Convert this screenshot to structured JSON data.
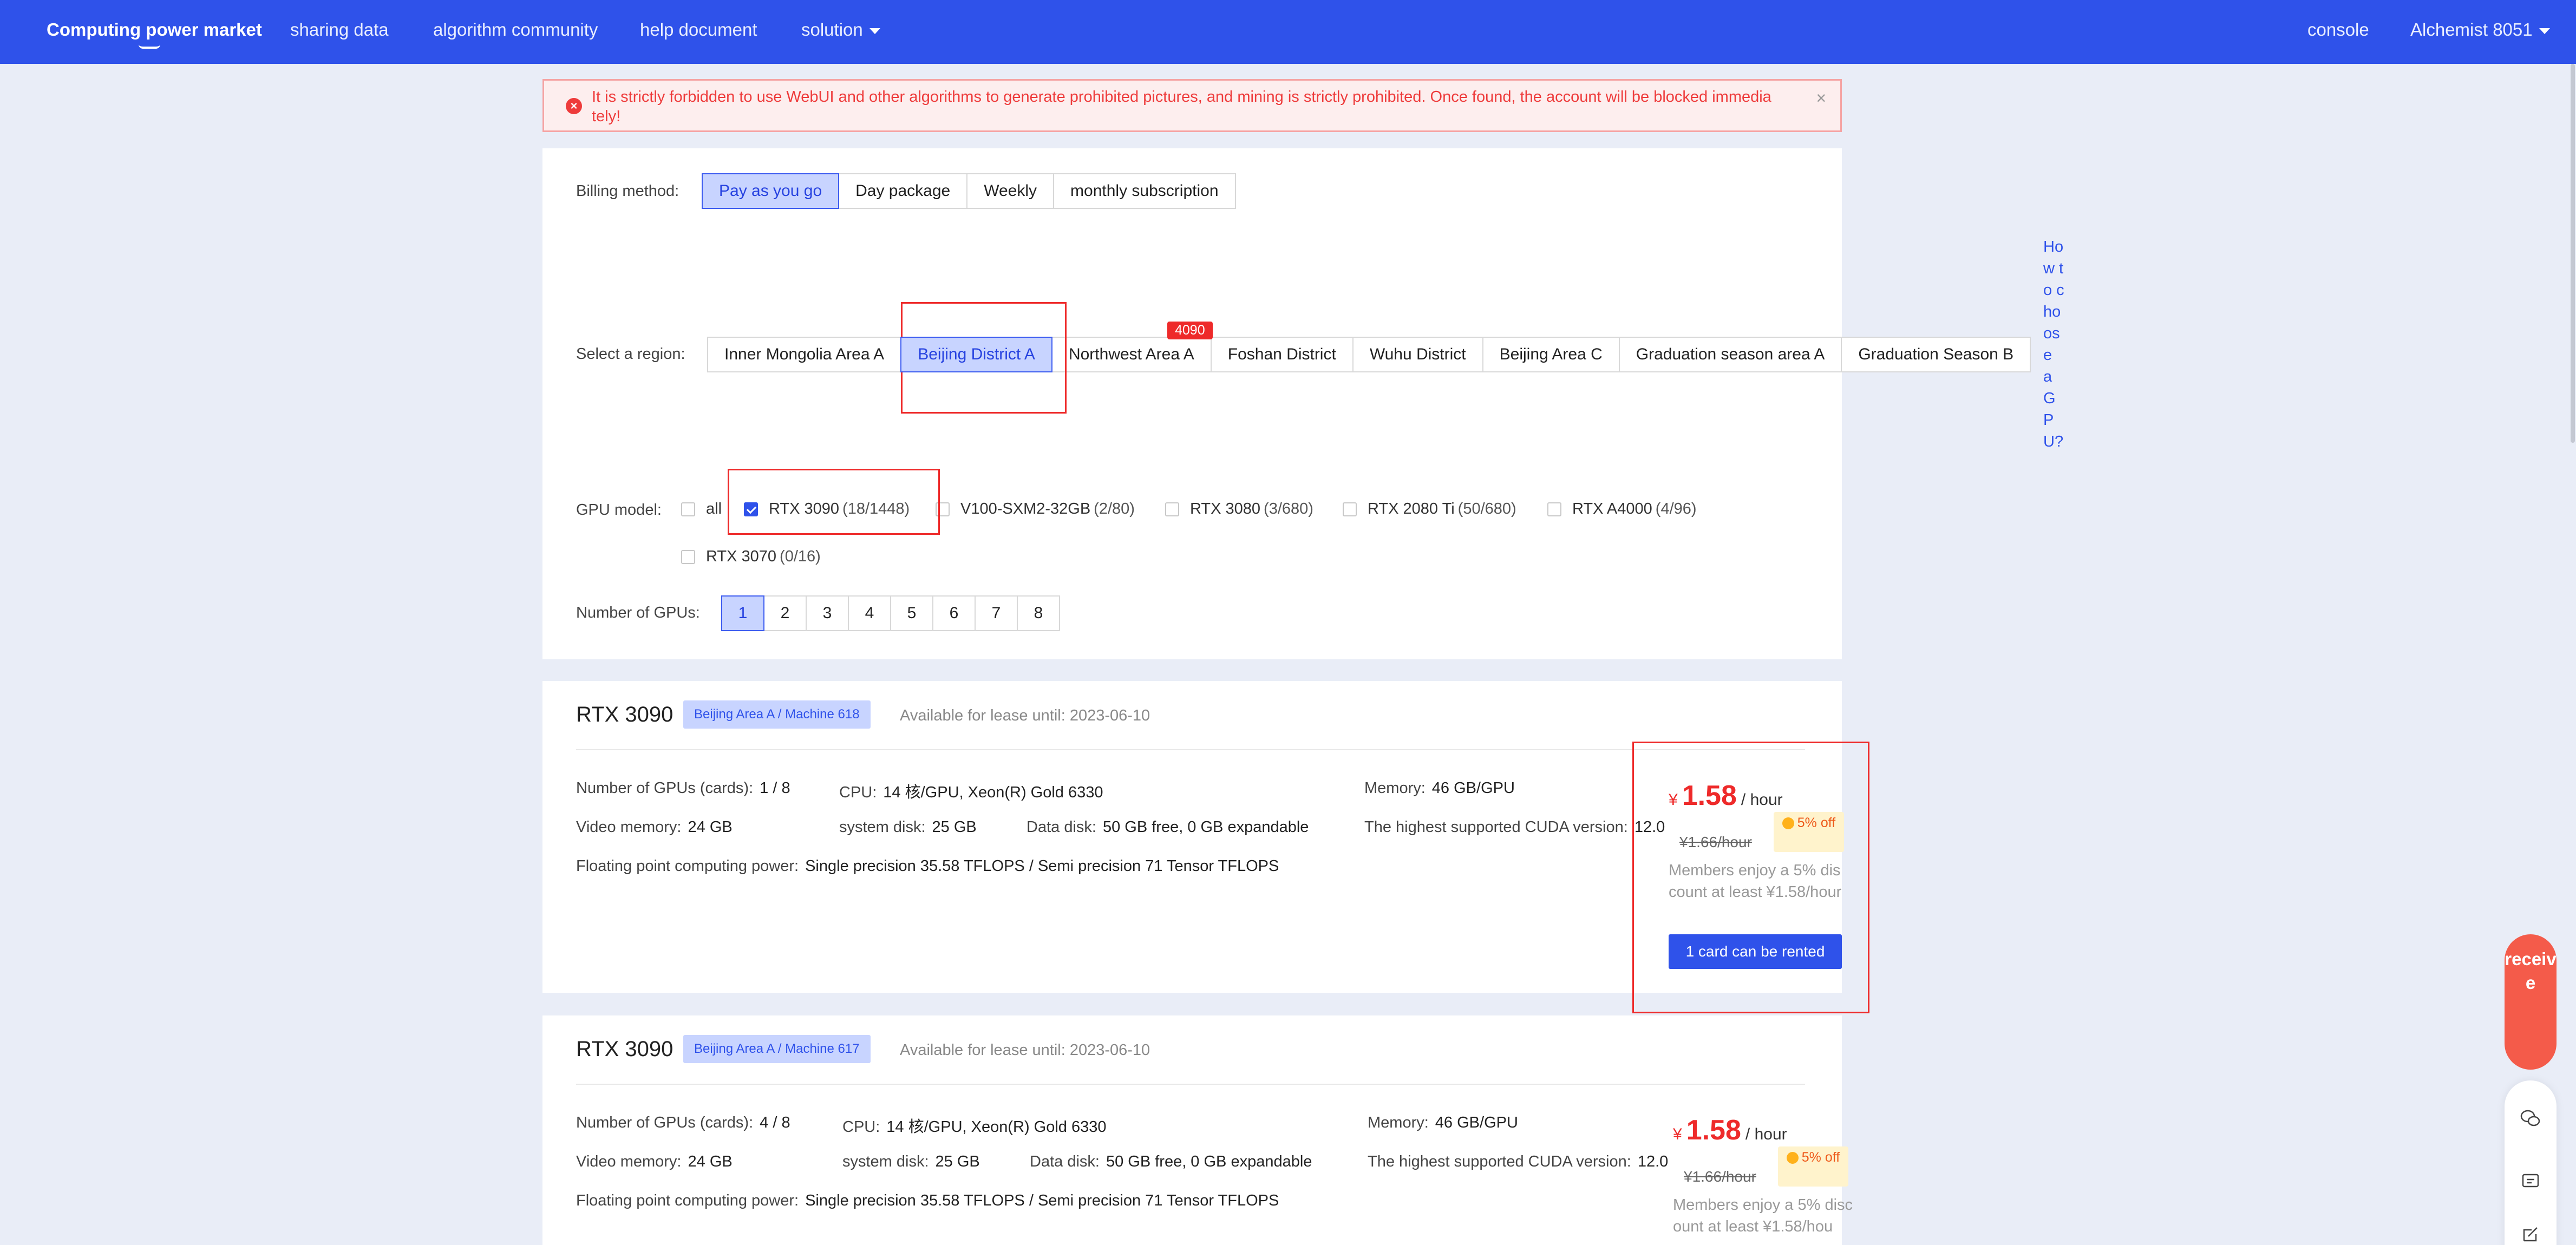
{
  "nav": {
    "items": [
      "Computing power market",
      "sharing data",
      "algorithm community",
      "help document"
    ],
    "solution": "solution",
    "console": "console",
    "user": "Alchemist 8051"
  },
  "warning": {
    "text": "It is strictly forbidden to use WebUI and other algorithms to generate prohibited pictures, and mining is strictly prohibited. Once found, the account will be blocked immedia tely!",
    "close": "×",
    "icon": "error-icon"
  },
  "filters": {
    "billing_label": "Billing method:",
    "billing_options": [
      "Pay as you go",
      "Day package",
      "Weekly",
      "monthly subscription"
    ],
    "billing_selected": "Pay as you go",
    "region_label": "Select a region:",
    "regions": [
      "Inner Mongolia Area A",
      "Beijing District A",
      "Northwest Area A",
      "Foshan District",
      "Wuhu District",
      "Beijing Area C",
      "Graduation season area A",
      "Graduation Season B"
    ],
    "region_selected": "Beijing District A",
    "region_badge": "4090",
    "gpu_label": "GPU model:",
    "gpu_options": [
      {
        "name": "all",
        "count": "",
        "checked": false
      },
      {
        "name": "RTX 3090",
        "count": "(18/1448)",
        "checked": true
      },
      {
        "name": "V100-SXM2-32GB",
        "count": "(2/80)",
        "checked": false
      },
      {
        "name": "RTX 3080",
        "count": "(3/680)",
        "checked": false
      },
      {
        "name": "RTX 2080 Ti",
        "count": "(50/680)",
        "checked": false
      },
      {
        "name": "RTX A4000",
        "count": "(4/96)",
        "checked": false
      },
      {
        "name": "RTX 3070",
        "count": "(0/16)",
        "checked": false
      }
    ],
    "num_label": "Number of GPUs:",
    "num_options": [
      "1",
      "2",
      "3",
      "4",
      "5",
      "6",
      "7",
      "8"
    ],
    "num_selected": "1"
  },
  "side_link": "How to choose a GPU?",
  "cards": [
    {
      "title": "RTX 3090",
      "tag": "Beijing Area A / Machine 618",
      "available": "Available for lease until: 2023-06-10",
      "gpus_label": "Number of GPUs (cards):",
      "gpus": "1 / 8",
      "cpu_label": "CPU:",
      "cpu": "14 核/GPU,  Xeon(R) Gold 6330",
      "memory_label": "Memory:",
      "memory": "46 GB/GPU",
      "vmem_label": "Video memory:",
      "vmem": "24 GB",
      "sysdisk_label": "system disk:",
      "sysdisk": "25 GB",
      "datadisk_label": "Data disk:",
      "datadisk": "50 GB free, 0 GB expandable",
      "cuda_label": "The highest supported CUDA version:",
      "cuda": "12.0",
      "flops_label": "Floating point computing power:",
      "flops": "Single precision 35.58 TFLOPS / Semi precision 71 Tensor TFLOPS",
      "currency": "¥",
      "price": "1.58",
      "unit": "/ hour",
      "old_price": "¥1.66/hour",
      "discount": "5% off",
      "member_note": "Members enjoy a 5% discount at least ¥1.58/hour",
      "rent_button": "1 card can be rented"
    },
    {
      "title": "RTX 3090",
      "tag": "Beijing Area A / Machine 617",
      "available": "Available for lease until: 2023-06-10",
      "gpus_label": "Number of GPUs (cards):",
      "gpus": "4 / 8",
      "cpu_label": "CPU:",
      "cpu": "14 核/GPU,  Xeon(R) Gold 6330",
      "memory_label": "Memory:",
      "memory": "46 GB/GPU",
      "vmem_label": "Video memory:",
      "vmem": "24 GB",
      "sysdisk_label": "system disk:",
      "sysdisk": "25 GB",
      "datadisk_label": "Data disk:",
      "datadisk": "50 GB free, 0 GB expandable",
      "cuda_label": "The highest supported CUDA version:",
      "cuda": "12.0",
      "flops_label": "Floating point computing power:",
      "flops": "Single precision 35.58 TFLOPS / Semi precision 71 Tensor TFLOPS",
      "currency": "¥",
      "price": "1.58",
      "unit": "/ hour",
      "old_price": "¥1.66/hour",
      "discount": "5% off",
      "member_note": "Members enjoy a 5% discount at least ¥1.58/hou"
    }
  ],
  "receive_widget": "receive",
  "tools": [
    "wechat-icon",
    "message-icon",
    "edit-icon"
  ],
  "colors": {
    "brand": "#2f52ea",
    "price": "#ee2a2a",
    "highlight_box": "#ee2a2a"
  }
}
